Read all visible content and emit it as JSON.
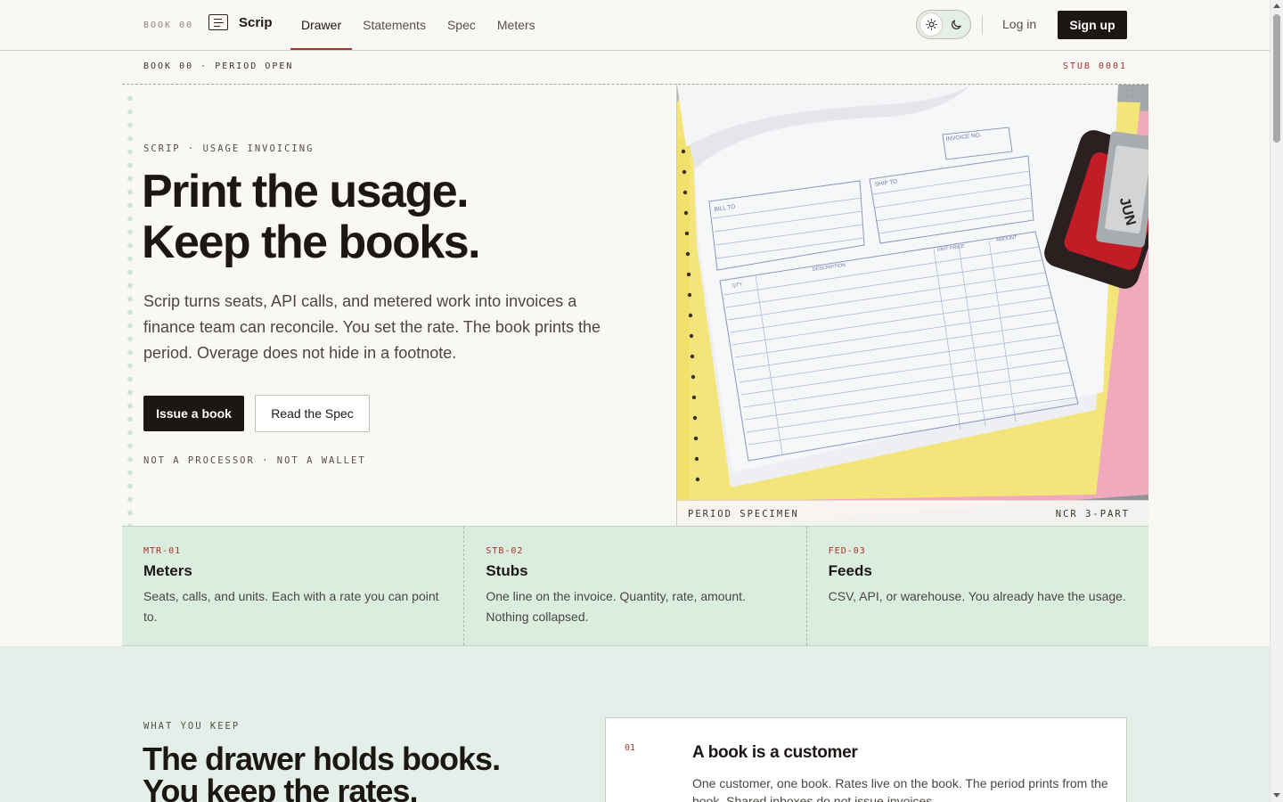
{
  "header": {
    "book_tag": "BOOK 00",
    "logo_text": "Scrip",
    "nav": [
      {
        "label": "Drawer",
        "active": true
      },
      {
        "label": "Statements",
        "active": false
      },
      {
        "label": "Spec",
        "active": false
      },
      {
        "label": "Meters",
        "active": false
      }
    ],
    "theme_toggle": {
      "options": [
        "sun-icon",
        "moon-icon"
      ],
      "selected": "light"
    },
    "login_label": "Log in",
    "signup_label": "Sign up"
  },
  "period": {
    "left": "BOOK 00 · PERIOD OPEN",
    "right": "STUB 0001"
  },
  "hero": {
    "eyebrow": "SCRIP · USAGE INVOICING",
    "title_line1": "Print the usage.",
    "title_line2": "Keep the books.",
    "subtitle": "Scrip turns seats, API calls, and metered work into invoices a finance team can reconcile. You set the rate. The book prints the period. Overage does not hide in a footnote.",
    "primary_cta": "Issue a book",
    "secondary_cta": "Read the Spec",
    "footnote": "NOT A PROCESSOR · NOT A WALLET"
  },
  "specimen": {
    "caption_left": "PERIOD SPECIMEN",
    "caption_right": "NCR 3-PART",
    "form_labels": {
      "invoice_no": "INVOICE NO.",
      "bill_to": "BILL TO",
      "ship_to": "SHIP TO",
      "qty": "QTY",
      "description": "DESCRIPTION",
      "unit_price": "UNIT PRICE",
      "amount": "AMOUNT"
    },
    "stamp_text": "JUN"
  },
  "features": [
    {
      "code": "MTR-01",
      "title": "Meters",
      "desc": "Seats, calls, and units. Each with a rate you can point to."
    },
    {
      "code": "STB-02",
      "title": "Stubs",
      "desc": "One line on the invoice. Quantity, rate, amount. Nothing collapsed."
    },
    {
      "code": "FED-03",
      "title": "Feeds",
      "desc": "CSV, API, or warehouse. You already have the usage."
    }
  ],
  "keep": {
    "eyebrow": "WHAT YOU KEEP",
    "title_line1": "The drawer holds books.",
    "title_line2": "You keep the rates.",
    "card": {
      "num": "01",
      "title": "A book is a customer",
      "desc": "One customer, one book. Rates live on the book. The period prints from the book. Shared inboxes do not issue invoices."
    }
  },
  "colors": {
    "accent": "#a8322e",
    "ink": "#1c1714",
    "paper": "#f9f8f5",
    "mint": "#dbeddf"
  }
}
